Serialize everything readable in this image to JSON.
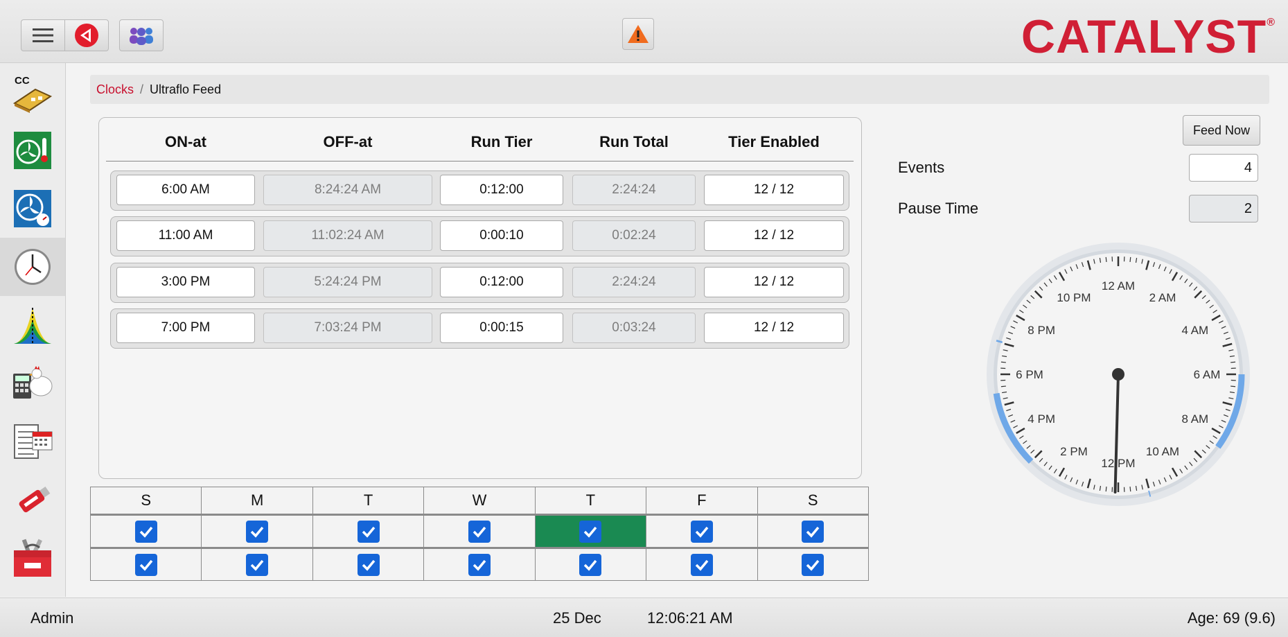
{
  "header": {
    "logo": "CATALYST",
    "logo_mark": "®",
    "icons": [
      "menu-icon",
      "back-icon",
      "users-icon",
      "warning-icon"
    ]
  },
  "sidebar": {
    "items": [
      {
        "name": "climate-control",
        "label": "CC",
        "icon": "barn-icon"
      },
      {
        "name": "fan-temperature",
        "icon": "fan-thermometer-icon"
      },
      {
        "name": "fan-speed",
        "icon": "fan-gauge-icon"
      },
      {
        "name": "clocks",
        "icon": "clock-icon",
        "active": true
      },
      {
        "name": "growth-curve",
        "icon": "curve-icon"
      },
      {
        "name": "bird-calculator",
        "icon": "chicken-calculator-icon"
      },
      {
        "name": "schedule-log",
        "icon": "calendar-log-icon"
      },
      {
        "name": "usb",
        "icon": "usb-drive-icon"
      },
      {
        "name": "toolbox",
        "icon": "toolbox-icon"
      }
    ]
  },
  "breadcrumb": {
    "parent": "Clocks",
    "separator": "/",
    "current": "Ultraflo Feed"
  },
  "schedule": {
    "columns": [
      "ON-at",
      "OFF-at",
      "Run Tier",
      "Run Total",
      "Tier Enabled"
    ],
    "rows": [
      {
        "on_at": "6:00 AM",
        "off_at": "8:24:24 AM",
        "run_tier": "0:12:00",
        "run_total": "2:24:24",
        "tier_enabled": "12 / 12"
      },
      {
        "on_at": "11:00 AM",
        "off_at": "11:02:24 AM",
        "run_tier": "0:00:10",
        "run_total": "0:02:24",
        "tier_enabled": "12 / 12"
      },
      {
        "on_at": "3:00 PM",
        "off_at": "5:24:24 PM",
        "run_tier": "0:12:00",
        "run_total": "2:24:24",
        "tier_enabled": "12 / 12"
      },
      {
        "on_at": "7:00 PM",
        "off_at": "7:03:24 PM",
        "run_tier": "0:00:15",
        "run_total": "0:03:24",
        "tier_enabled": "12 / 12"
      }
    ]
  },
  "days": {
    "labels": [
      "S",
      "M",
      "T",
      "W",
      "T",
      "F",
      "S"
    ],
    "today_index": 4,
    "rows": [
      [
        true,
        true,
        true,
        true,
        true,
        true,
        true
      ],
      [
        true,
        true,
        true,
        true,
        true,
        true,
        true
      ]
    ]
  },
  "controls": {
    "feed_now": "Feed Now",
    "events_label": "Events",
    "events_value": "4",
    "pause_label": "Pause Time",
    "pause_value": "2"
  },
  "clock": {
    "labels": [
      "12 AM",
      "2 AM",
      "4 AM",
      "6 AM",
      "8 AM",
      "10 AM",
      "12 PM",
      "2 PM",
      "4 PM",
      "6 PM",
      "8 PM",
      "10 PM"
    ],
    "hand_time": "12:06",
    "colors": {
      "active_arc": "#6fa8e8",
      "face": "#f4f4f4",
      "ring": "#d8dde3"
    }
  },
  "footer": {
    "user": "Admin",
    "date": "25 Dec",
    "time": "12:06:21 AM",
    "age": "Age: 69 (9.6)"
  },
  "colors": {
    "accent": "#c8102e",
    "checkbox": "#1565d8",
    "today": "#1a8a52"
  }
}
